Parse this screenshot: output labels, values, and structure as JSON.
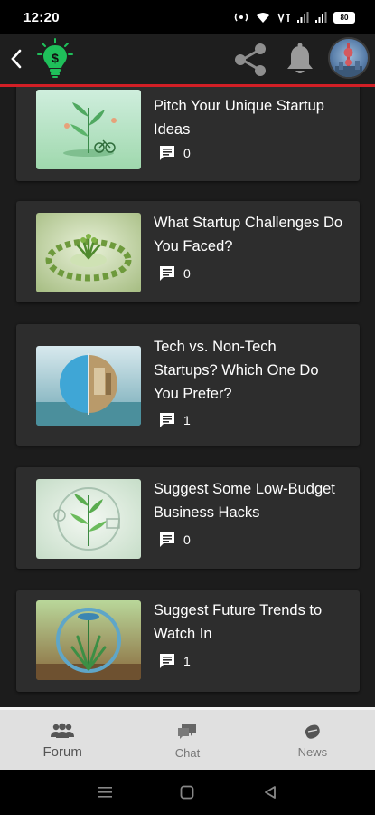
{
  "status_bar": {
    "time": "12:20",
    "battery": "80",
    "icons": [
      "hotspot-icon",
      "wifi-icon",
      "volte-icon",
      "signal-icon",
      "signal-icon",
      "battery-icon"
    ]
  },
  "app_bar": {
    "accent_color": "#d21f26",
    "logo_icon": "bulb-dollar-icon",
    "back_icon": "chevron-left-icon",
    "share_icon": "share-icon",
    "bell_icon": "bell-icon"
  },
  "posts": [
    {
      "title": "Pitch Your Unique Startup Ideas",
      "comments": "0",
      "thumb": "sprout-with-bicycle"
    },
    {
      "title": "What Startup Challenges Do You Faced?",
      "comments": "0",
      "thumb": "plant-ring"
    },
    {
      "title": "Tech vs. Non-Tech Startups? Which One Do You Prefer?",
      "comments": "1",
      "thumb": "split-globe"
    },
    {
      "title": "Suggest Some Low-Budget Business Hacks",
      "comments": "0",
      "thumb": "plant-in-bulb"
    },
    {
      "title": "Suggest Future Trends to Watch In",
      "comments": "1",
      "thumb": "plant-in-glass-sphere"
    }
  ],
  "bottom_nav": {
    "items": [
      {
        "label": "Forum",
        "icon": "people-icon",
        "active": true
      },
      {
        "label": "Chat",
        "icon": "chat-icon",
        "active": false
      },
      {
        "label": "News",
        "icon": "news-icon",
        "active": false
      }
    ]
  }
}
